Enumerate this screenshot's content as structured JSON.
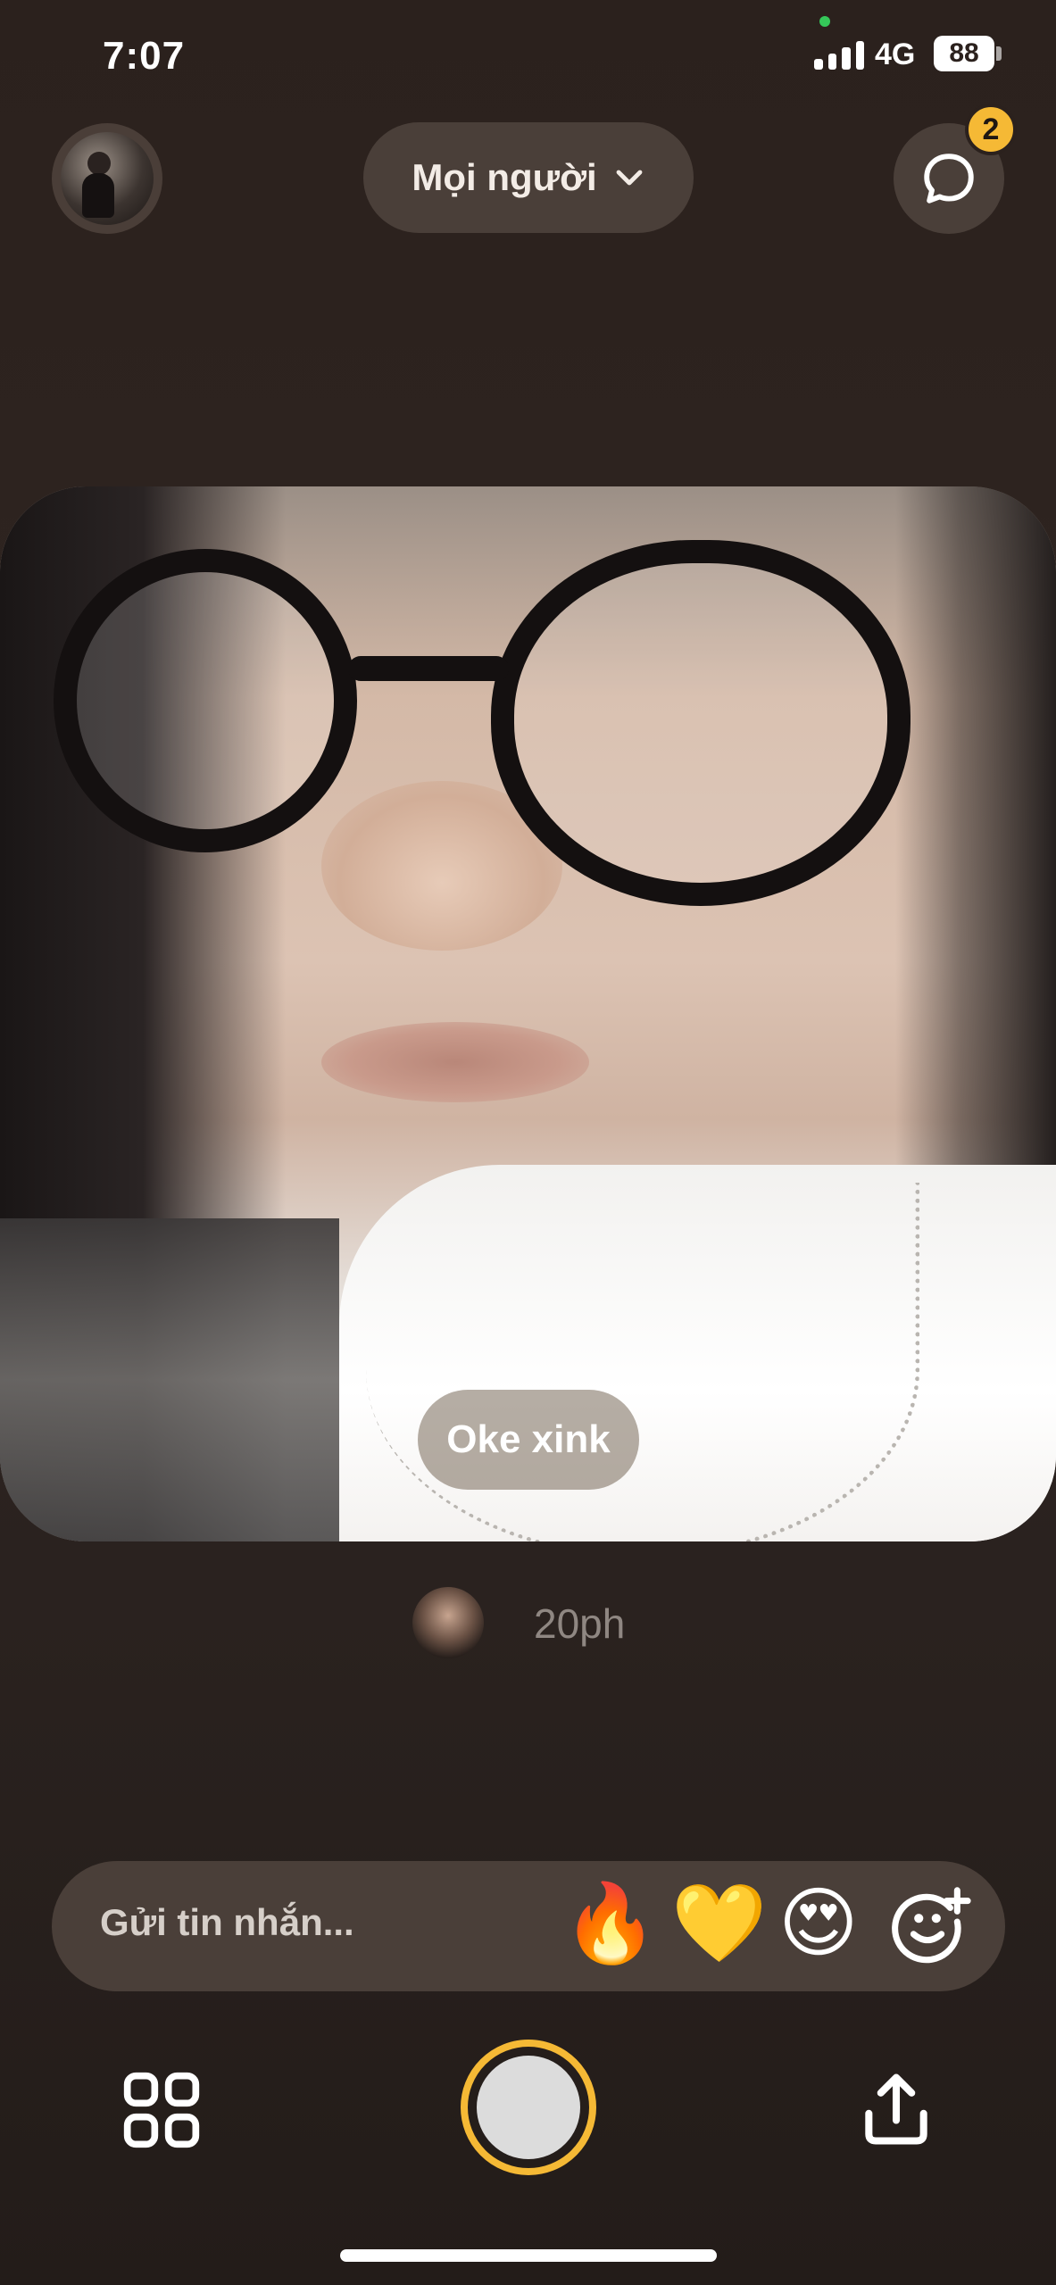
{
  "status_bar": {
    "time": "7:07",
    "network": "4G",
    "battery": "88"
  },
  "header": {
    "audience_label": "Mọi người",
    "chat_badge_count": "2"
  },
  "post": {
    "caption": "Oke xink",
    "time_ago": "20ph"
  },
  "message_bar": {
    "placeholder": "Gửi tin nhắn...",
    "reactions": [
      "🔥",
      "💛",
      "😍"
    ]
  },
  "icons": {
    "profile": "avatar",
    "audience_toggle": "chevron-down-icon",
    "chat": "chat-bubble-icon",
    "add_reaction": "add-reaction-icon",
    "history": "grid-icon",
    "capture": "shutter-button",
    "share": "share-upload-icon"
  },
  "colors": {
    "accent": "#f5b935",
    "background": "#2b211d",
    "chip": "#4a3f39"
  }
}
